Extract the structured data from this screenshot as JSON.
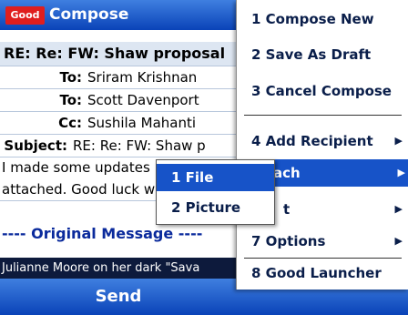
{
  "app": {
    "logo_text": "Good",
    "title": "Compose"
  },
  "compose": {
    "subject_header": "RE: Re: FW: Shaw proposal",
    "fields": [
      {
        "label": "To:",
        "value": "Sriram Krishnan"
      },
      {
        "label": "To:",
        "value": "Scott Davenport"
      },
      {
        "label": "Cc:",
        "value": "Sushila Mahanti"
      },
      {
        "label": "Subject:",
        "value": "RE: Re: FW: Shaw p"
      }
    ],
    "body_lines": [
      "I made some updates",
      "attached.  Good luck w"
    ],
    "original_message": "---- Original Message ----",
    "teaser": "Julianne Moore on her dark \"Sava"
  },
  "softkeys": {
    "left": "Send"
  },
  "menu": {
    "items": [
      {
        "label": "1 Compose New",
        "submenu": false
      },
      {
        "label": "2 Save As Draft",
        "submenu": false
      },
      {
        "label": "3 Cancel Compose",
        "submenu": false
      },
      {
        "label": "4 Add Recipient",
        "submenu": true
      },
      {
        "label": "5 Attach",
        "visible_text": "ach",
        "submenu": true,
        "selected": true
      },
      {
        "label": "6 Format",
        "visible_text": "t",
        "submenu": true
      },
      {
        "label": "7 Options",
        "submenu": true
      },
      {
        "label": "8 Good Launcher",
        "submenu": false
      }
    ]
  },
  "submenu": {
    "items": [
      {
        "label": "1 File",
        "selected": true
      },
      {
        "label": "2 Picture",
        "selected": false
      }
    ]
  },
  "colors": {
    "selection": "#1753c8",
    "titlebar": "#0a43b8",
    "logo": "#e01e1e"
  }
}
